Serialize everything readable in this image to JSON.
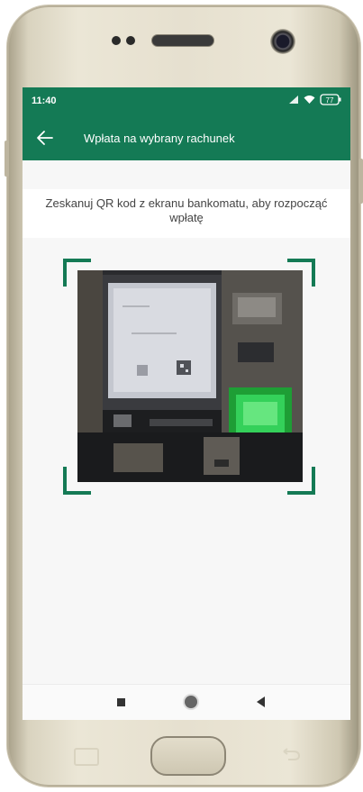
{
  "status_bar": {
    "time": "11:40",
    "battery": "77",
    "icons": [
      "signal-icon",
      "wifi-icon",
      "battery-icon"
    ]
  },
  "header": {
    "title": "Wpłata na wybrany rachunek",
    "back_icon": "arrow-left-icon"
  },
  "instruction": {
    "text": "Zeskanuj QR kod z ekranu bankomatu, aby rozpocząć wpłatę"
  },
  "scanner": {
    "frame_color": "#147a55",
    "preview": "camera-preview"
  },
  "nav_bar": {
    "icons": [
      "recent-apps-icon",
      "home-icon",
      "back-icon"
    ]
  },
  "colors": {
    "brand_green": "#147a55",
    "background": "#f7f7f7",
    "text": "#444444"
  }
}
